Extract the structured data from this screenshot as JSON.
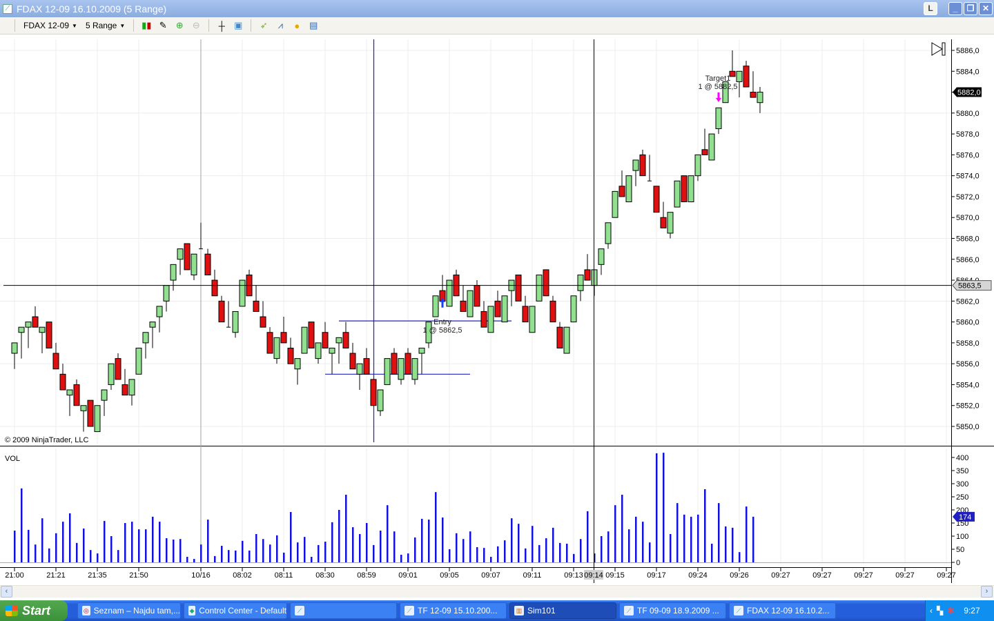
{
  "window": {
    "title": "FDAX 12-09  16.10.2009 (5 Range)",
    "buttons": [
      "L",
      "minimize",
      "restore",
      "close"
    ]
  },
  "toolbar": {
    "instrument": "FDAX 12-09",
    "bar_type": "5 Range",
    "icons": [
      "bar-style-icon",
      "draw-tool-icon",
      "zoom-in-icon",
      "zoom-out-icon",
      "crosshair-icon",
      "properties-icon",
      "strategies-icon",
      "indicators-icon",
      "order-icon",
      "data-box-icon"
    ]
  },
  "chart": {
    "copyright": "© 2009 NinjaTrader, LLC",
    "volume_label": "VOL",
    "last_price_label": "5882,0",
    "crosshair_price_label": "5863,5",
    "crosshair_time_label": "09:14",
    "last_volume_label": "174",
    "entry": {
      "title": "Entry",
      "detail": "1 @ 5862,5"
    },
    "target": {
      "title": "Target1",
      "detail": "1 @ 5882,5"
    },
    "colors": {
      "up": "#90e090",
      "down": "#e01010",
      "volume": "#1010e0",
      "drawing": "#2020c0",
      "entry_arrow": "#1040ff",
      "target_arrow": "#ff00ff"
    }
  },
  "chart_data": {
    "type": "candlestick",
    "price_axis": {
      "min": 5850,
      "max": 5886,
      "ticks": [
        "5886,0",
        "5884,0",
        "5882,0",
        "5880,0",
        "5878,0",
        "5876,0",
        "5874,0",
        "5872,0",
        "5870,0",
        "5868,0",
        "5866,0",
        "5864,0",
        "5862,0",
        "5860,0",
        "5858,0",
        "5856,0",
        "5854,0",
        "5852,0",
        "5850,0"
      ]
    },
    "volume_axis": {
      "min": 0,
      "max": 400,
      "ticks": [
        "400",
        "350",
        "300",
        "250",
        "200",
        "150",
        "100",
        "50",
        "0"
      ]
    },
    "time_ticks": [
      {
        "label": "21:00",
        "bar": 0
      },
      {
        "label": "21:21",
        "bar": 6
      },
      {
        "label": "21:35",
        "bar": 12
      },
      {
        "label": "21:50",
        "bar": 18
      },
      {
        "label": "10/16",
        "bar": 27
      },
      {
        "label": "08:02",
        "bar": 33
      },
      {
        "label": "08:11",
        "bar": 39
      },
      {
        "label": "08:30",
        "bar": 45
      },
      {
        "label": "08:59",
        "bar": 51
      },
      {
        "label": "09:01",
        "bar": 57
      },
      {
        "label": "09:05",
        "bar": 63
      },
      {
        "label": "09:07",
        "bar": 69
      },
      {
        "label": "09:11",
        "bar": 75
      },
      {
        "label": "09:13",
        "bar": 81
      },
      {
        "label": "09:15",
        "bar": 87
      },
      {
        "label": "09:17",
        "bar": 93
      },
      {
        "label": "09:24",
        "bar": 99
      },
      {
        "label": "09:26",
        "bar": 105
      },
      {
        "label": "09:27",
        "bar": 111
      },
      {
        "label": "09:27",
        "bar": 117
      },
      {
        "label": "09:27",
        "bar": 123
      },
      {
        "label": "09:27",
        "bar": 129
      },
      {
        "label": "09:27",
        "bar": 135
      }
    ],
    "ohlc": [
      [
        5857,
        5858,
        5855.5,
        5858
      ],
      [
        5859,
        5859.5,
        5856.5,
        5859.5
      ],
      [
        5859.5,
        5860,
        5857.5,
        5860
      ],
      [
        5860.5,
        5861.5,
        5859.5,
        5859.5
      ],
      [
        5859,
        5859.5,
        5857,
        5859.5
      ],
      [
        5860,
        5860,
        5857.5,
        5857.5
      ],
      [
        5857,
        5858,
        5855.5,
        5855.5
      ],
      [
        5855,
        5856,
        5853.5,
        5853.5
      ],
      [
        5853,
        5853.5,
        5851,
        5853.5
      ],
      [
        5854,
        5854.5,
        5852,
        5852
      ],
      [
        5851.5,
        5852,
        5849.5,
        5852
      ],
      [
        5852.5,
        5852.5,
        5850,
        5850
      ],
      [
        5849.5,
        5852,
        5849.5,
        5852
      ],
      [
        5852.5,
        5853.5,
        5851,
        5853.5
      ],
      [
        5854,
        5856,
        5853.5,
        5856
      ],
      [
        5856.5,
        5857,
        5854.5,
        5854.5
      ],
      [
        5854,
        5855.5,
        5853,
        5853
      ],
      [
        5853,
        5854.5,
        5852,
        5854.5
      ],
      [
        5855,
        5857.5,
        5855,
        5857.5
      ],
      [
        5858,
        5859,
        5856.5,
        5859
      ],
      [
        5859.5,
        5860,
        5857.5,
        5860
      ],
      [
        5860.5,
        5861.5,
        5859,
        5861.5
      ],
      [
        5862,
        5863.5,
        5861,
        5863.5
      ],
      [
        5864,
        5865.5,
        5863,
        5865.5
      ],
      [
        5866,
        5867,
        5864.5,
        5867
      ],
      [
        5867.5,
        5867.5,
        5865,
        5865
      ],
      [
        5864.5,
        5866.5,
        5864,
        5866.5
      ],
      [
        5867,
        5869.5,
        5867,
        5867
      ],
      [
        5866.5,
        5867,
        5864.5,
        5864.5
      ],
      [
        5864,
        5865,
        5862.5,
        5862.5
      ],
      [
        5862,
        5862.5,
        5860,
        5860
      ],
      [
        5859.5,
        5862,
        5859.5,
        5859.5
      ],
      [
        5859,
        5861,
        5858.5,
        5861
      ],
      [
        5861.5,
        5864,
        5861.5,
        5864
      ],
      [
        5864.5,
        5865,
        5862.5,
        5862.5
      ],
      [
        5862,
        5863.5,
        5861,
        5861
      ],
      [
        5860.5,
        5862,
        5859.5,
        5859.5
      ],
      [
        5859,
        5859.5,
        5857,
        5857
      ],
      [
        5856.5,
        5858.5,
        5856,
        5858.5
      ],
      [
        5859,
        5860.5,
        5858,
        5858
      ],
      [
        5857.5,
        5858.5,
        5856,
        5856
      ],
      [
        5855.5,
        5856.5,
        5854,
        5856.5
      ],
      [
        5857,
        5859.5,
        5857,
        5859.5
      ],
      [
        5860,
        5860,
        5857.5,
        5857.5
      ],
      [
        5856.5,
        5858,
        5856,
        5858
      ],
      [
        5859,
        5860,
        5857.5,
        5857.5
      ],
      [
        5857,
        5857.5,
        5855,
        5857.5
      ],
      [
        5858,
        5858.5,
        5856,
        5858.5
      ],
      [
        5859,
        5860,
        5857.5,
        5857.5
      ],
      [
        5857,
        5858,
        5855.5,
        5855.5
      ],
      [
        5855,
        5856,
        5853.5,
        5856
      ],
      [
        5856.5,
        5857.5,
        5855,
        5855
      ],
      [
        5854.5,
        5854.5,
        5852,
        5852
      ],
      [
        5851.5,
        5853.5,
        5851,
        5853.5
      ],
      [
        5854,
        5856.5,
        5854,
        5856.5
      ],
      [
        5857,
        5857.5,
        5855,
        5855
      ],
      [
        5854.5,
        5856.5,
        5854,
        5856.5
      ],
      [
        5857,
        5857.5,
        5855,
        5855
      ],
      [
        5854.5,
        5856.5,
        5854,
        5856.5
      ],
      [
        5857,
        5857.5,
        5855,
        5857.5
      ],
      [
        5858,
        5860,
        5857.5,
        5860
      ],
      [
        5860.5,
        5862.5,
        5860.5,
        5862.5
      ],
      [
        5863,
        5864.5,
        5862,
        5862
      ],
      [
        5861.5,
        5864,
        5861.5,
        5864
      ],
      [
        5864.5,
        5865,
        5862.5,
        5862.5
      ],
      [
        5862,
        5863.5,
        5861,
        5861
      ],
      [
        5860.5,
        5863,
        5860.5,
        5863
      ],
      [
        5863.5,
        5864,
        5861.5,
        5861.5
      ],
      [
        5861,
        5862,
        5859.5,
        5859.5
      ],
      [
        5859,
        5861.5,
        5859,
        5861.5
      ],
      [
        5862,
        5863,
        5860.5,
        5860.5
      ],
      [
        5860,
        5862.5,
        5860,
        5862.5
      ],
      [
        5863,
        5864,
        5861.5,
        5864
      ],
      [
        5864.5,
        5864.5,
        5862,
        5862
      ],
      [
        5861.5,
        5862.5,
        5860,
        5860
      ],
      [
        5859,
        5861.5,
        5859,
        5861.5
      ],
      [
        5862,
        5864.5,
        5862,
        5864.5
      ],
      [
        5865,
        5865,
        5862.5,
        5862.5
      ],
      [
        5862,
        5862.5,
        5860,
        5860
      ],
      [
        5859.5,
        5860,
        5857.5,
        5857.5
      ],
      [
        5857,
        5859.5,
        5857,
        5859.5
      ],
      [
        5860,
        5862.5,
        5860,
        5862.5
      ],
      [
        5863,
        5864.5,
        5862,
        5864.5
      ],
      [
        5865,
        5866.5,
        5864,
        5864
      ],
      [
        5863.5,
        5865,
        5862.5,
        5865
      ],
      [
        5865.5,
        5867,
        5864.5,
        5867
      ],
      [
        5867.5,
        5869.5,
        5867,
        5869.5
      ],
      [
        5870,
        5872.5,
        5870,
        5872.5
      ],
      [
        5873,
        5874.5,
        5872,
        5872
      ],
      [
        5871.5,
        5874,
        5871.5,
        5874
      ],
      [
        5874.5,
        5875.5,
        5873,
        5875.5
      ],
      [
        5876,
        5876.5,
        5874,
        5874
      ],
      [
        5873.5,
        5876,
        5873.5,
        5873.5
      ],
      [
        5873,
        5873,
        5870.5,
        5870.5
      ],
      [
        5870,
        5871.5,
        5869,
        5869
      ],
      [
        5868.5,
        5870.5,
        5868,
        5870.5
      ],
      [
        5871,
        5873.5,
        5871,
        5873.5
      ],
      [
        5874,
        5874,
        5871.5,
        5871.5
      ],
      [
        5871.5,
        5874,
        5871.5,
        5874
      ],
      [
        5874,
        5876,
        5873.5,
        5876
      ],
      [
        5876.5,
        5878.5,
        5876,
        5876
      ],
      [
        5875.5,
        5878,
        5875.5,
        5878
      ],
      [
        5878.5,
        5880.5,
        5878,
        5880.5
      ],
      [
        5881,
        5883,
        5881,
        5883
      ],
      [
        5884,
        5886,
        5883.5,
        5883.5
      ],
      [
        5883,
        5884,
        5881.5,
        5884
      ],
      [
        5884.5,
        5885,
        5882.5,
        5882.5
      ],
      [
        5882,
        5884,
        5881.5,
        5881.5
      ],
      [
        5881,
        5882.5,
        5880,
        5882
      ]
    ],
    "volume": [
      121,
      282,
      124,
      68,
      168,
      53,
      111,
      155,
      187,
      74,
      129,
      47,
      34,
      158,
      100,
      47,
      150,
      155,
      126,
      126,
      174,
      155,
      92,
      87,
      89,
      21,
      13,
      68,
      163,
      24,
      63,
      47,
      45,
      82,
      45,
      108,
      89,
      68,
      103,
      37,
      192,
      76,
      97,
      21,
      66,
      79,
      153,
      200,
      258,
      134,
      108,
      150,
      66,
      121,
      218,
      118,
      29,
      34,
      95,
      166,
      163,
      268,
      171,
      50,
      111,
      89,
      118,
      58,
      55,
      21,
      61,
      84,
      168,
      147,
      53,
      139,
      66,
      92,
      132,
      74,
      71,
      32,
      89,
      195,
      34,
      100,
      118,
      218,
      258,
      126,
      174,
      155,
      76,
      416,
      418,
      108,
      226,
      182,
      174,
      182,
      279,
      71,
      226,
      137,
      132,
      39,
      213,
      174
    ],
    "last_price": 5882.0,
    "crosshair_price": 5863.5,
    "entry_price": 5862.5,
    "target_price": 5882.5
  },
  "taskbar": {
    "start": "Start",
    "items": [
      {
        "label": "Seznam – Najdu tam,...",
        "active": false
      },
      {
        "label": "Control Center - Default",
        "active": false
      },
      {
        "label": "",
        "active": false
      },
      {
        "label": "TF 12-09  15.10.200...",
        "active": false
      },
      {
        "label": "Sim101",
        "active": true
      },
      {
        "label": "TF 09-09  18.9.2009 ...",
        "active": false
      },
      {
        "label": "FDAX 12-09  16.10.2...",
        "active": false
      }
    ],
    "clock": "9:27"
  }
}
